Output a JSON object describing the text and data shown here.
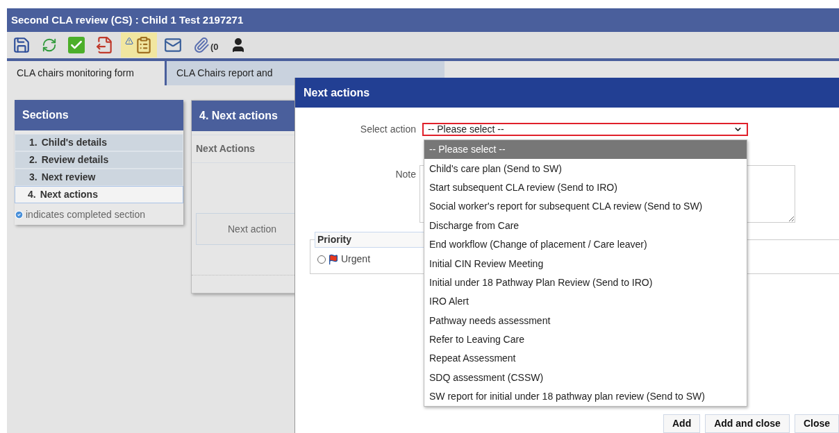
{
  "window": {
    "title": "Second CLA review (CS) :  Child 1 Test  2197271"
  },
  "toolbar": [
    {
      "kind": "save",
      "highlighted": false
    },
    {
      "kind": "refresh",
      "highlighted": false
    },
    {
      "kind": "check",
      "highlighted": false
    },
    {
      "kind": "export",
      "highlighted": false
    },
    {
      "kind": "alert-clipboard",
      "highlighted": true
    },
    {
      "kind": "letter",
      "highlighted": false
    },
    {
      "kind": "attachment",
      "label": "(0",
      "highlighted": false
    },
    {
      "kind": "person",
      "highlighted": false
    }
  ],
  "tabs": [
    {
      "label": "CLA chairs monitoring form",
      "selected": true
    },
    {
      "label": "CLA Chairs report and",
      "selected": false
    }
  ],
  "sections": {
    "title": "Sections",
    "items": [
      {
        "number": "1.",
        "label": "Child's details",
        "selected": false
      },
      {
        "number": "2.",
        "label": "Review details",
        "selected": false
      },
      {
        "number": "3.",
        "label": "Next review",
        "selected": false
      },
      {
        "number": "4.",
        "label": "Next actions",
        "selected": true
      }
    ],
    "legend": "indicates completed section"
  },
  "panel": {
    "title": "4. Next actions",
    "subtitle": "Next Actions",
    "button": "Next action"
  },
  "dialog": {
    "title": "Next actions",
    "select": {
      "label": "Select action",
      "value": "-- Please select --",
      "expanded": true,
      "options": [
        {
          "label": "-- Please select --",
          "selected": true
        },
        {
          "label": "Child's care plan (Send to SW)",
          "selected": false
        },
        {
          "label": "Start subsequent CLA review (Send to IRO)",
          "selected": false
        },
        {
          "label": "Social worker's report for subsequent CLA review (Send to SW)",
          "selected": false
        },
        {
          "label": "Discharge from Care",
          "selected": false
        },
        {
          "label": "End workflow (Change of placement / Care leaver)",
          "selected": false
        },
        {
          "label": "Initial CIN Review Meeting",
          "selected": false
        },
        {
          "label": "Initial under 18 Pathway Plan Review (Send to IRO)",
          "selected": false
        },
        {
          "label": "IRO Alert",
          "selected": false
        },
        {
          "label": "Pathway needs assessment",
          "selected": false
        },
        {
          "label": "Refer to Leaving Care",
          "selected": false
        },
        {
          "label": "Repeat Assessment",
          "selected": false
        },
        {
          "label": "SDQ assessment (CSSW)",
          "selected": false
        },
        {
          "label": "SW report for initial under 18 pathway plan review (Send to SW)",
          "selected": false
        }
      ]
    },
    "note": {
      "label": "Note"
    },
    "priority": {
      "legend": "Priority",
      "options": [
        {
          "label": "Urgent",
          "selected": false
        }
      ]
    },
    "buttons": [
      "Add",
      "Add and close",
      "Close"
    ]
  }
}
